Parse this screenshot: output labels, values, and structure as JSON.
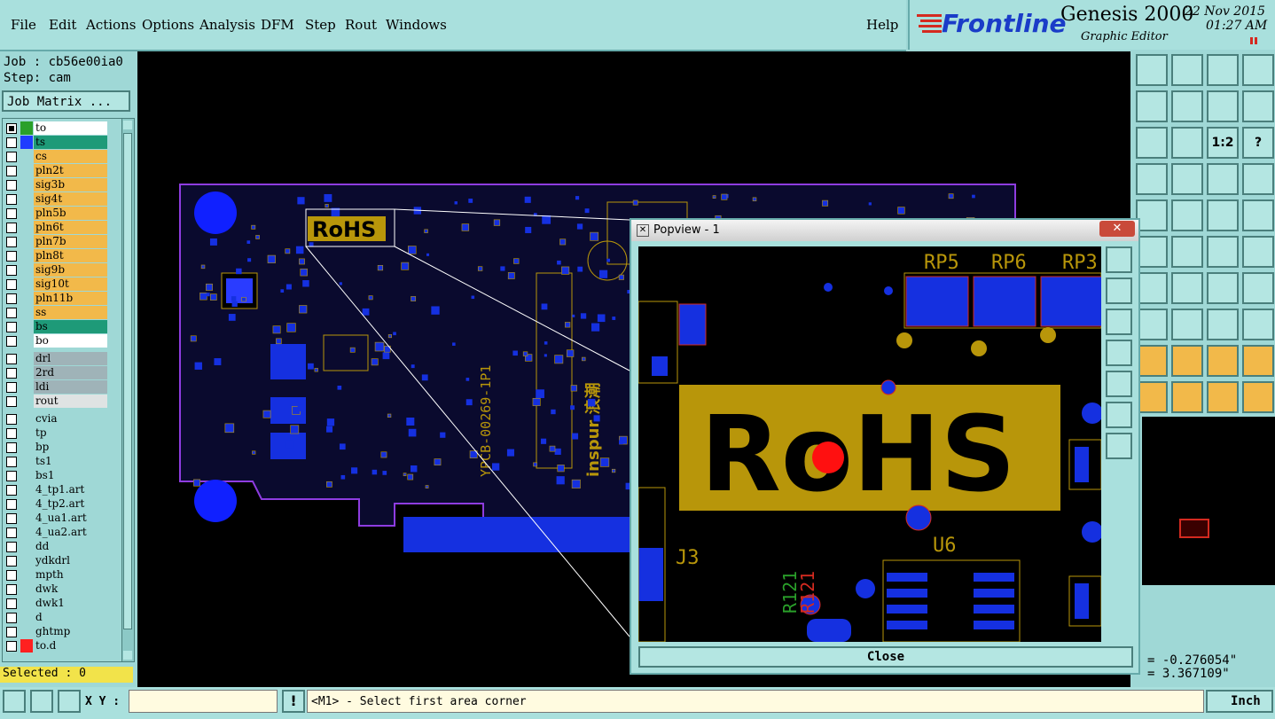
{
  "menu": {
    "items": [
      "File",
      "Edit",
      "Actions",
      "Options",
      "Analysis",
      "DFM",
      "Step",
      "Rout",
      "Windows"
    ],
    "help": "Help"
  },
  "brand": {
    "logo": "Frontline",
    "product": "Genesis 2000",
    "subtitle": "Graphic Editor",
    "date": "22 Nov 2015",
    "time": "01:27 AM"
  },
  "job": {
    "job_label": "Job : cb56e00ia0",
    "step_label": "Step: cam",
    "matrix_button": "Job Matrix ..."
  },
  "layers": [
    {
      "name": "to",
      "bg": "#ffffff",
      "color": "#2aa02a",
      "sel": true
    },
    {
      "name": "ts",
      "bg": "#1e9a78",
      "color": "#1f3cff",
      "sel": false
    },
    {
      "name": "cs",
      "bg": "#f2b94a",
      "color": "",
      "sel": false
    },
    {
      "name": "pln2t",
      "bg": "#f2b94a",
      "color": "",
      "sel": false
    },
    {
      "name": "sig3b",
      "bg": "#f2b94a",
      "color": "",
      "sel": false
    },
    {
      "name": "sig4t",
      "bg": "#f2b94a",
      "color": "",
      "sel": false
    },
    {
      "name": "pln5b",
      "bg": "#f2b94a",
      "color": "",
      "sel": false
    },
    {
      "name": "pln6t",
      "bg": "#f2b94a",
      "color": "",
      "sel": false
    },
    {
      "name": "pln7b",
      "bg": "#f2b94a",
      "color": "",
      "sel": false
    },
    {
      "name": "pln8t",
      "bg": "#f2b94a",
      "color": "",
      "sel": false
    },
    {
      "name": "sig9b",
      "bg": "#f2b94a",
      "color": "",
      "sel": false
    },
    {
      "name": "sig10t",
      "bg": "#f2b94a",
      "color": "",
      "sel": false
    },
    {
      "name": "pln11b",
      "bg": "#f2b94a",
      "color": "",
      "sel": false
    },
    {
      "name": "ss",
      "bg": "#f2b94a",
      "color": "",
      "sel": false
    },
    {
      "name": "bs",
      "bg": "#1e9a78",
      "color": "",
      "sel": false
    },
    {
      "name": "bo",
      "bg": "#ffffff",
      "color": "",
      "sel": false
    },
    {
      "name": "drl",
      "bg": "#9fb3b8",
      "color": "",
      "sel": false
    },
    {
      "name": "2rd",
      "bg": "#9fb3b8",
      "color": "",
      "sel": false
    },
    {
      "name": "ldi",
      "bg": "#9fb3b8",
      "color": "",
      "sel": false
    },
    {
      "name": "rout",
      "bg": "#dfe3e3",
      "color": "",
      "sel": false
    },
    {
      "name": "cvia",
      "bg": "#9fd8d6",
      "color": "",
      "sel": false
    },
    {
      "name": "tp",
      "bg": "#9fd8d6",
      "color": "",
      "sel": false
    },
    {
      "name": "bp",
      "bg": "#9fd8d6",
      "color": "",
      "sel": false
    },
    {
      "name": "ts1",
      "bg": "#9fd8d6",
      "color": "",
      "sel": false
    },
    {
      "name": "bs1",
      "bg": "#9fd8d6",
      "color": "",
      "sel": false
    },
    {
      "name": "4_tp1.art",
      "bg": "#9fd8d6",
      "color": "",
      "sel": false
    },
    {
      "name": "4_tp2.art",
      "bg": "#9fd8d6",
      "color": "",
      "sel": false
    },
    {
      "name": "4_ua1.art",
      "bg": "#9fd8d6",
      "color": "",
      "sel": false
    },
    {
      "name": "4_ua2.art",
      "bg": "#9fd8d6",
      "color": "",
      "sel": false
    },
    {
      "name": "dd",
      "bg": "#9fd8d6",
      "color": "",
      "sel": false
    },
    {
      "name": "ydkdrl",
      "bg": "#9fd8d6",
      "color": "",
      "sel": false
    },
    {
      "name": "mpth",
      "bg": "#9fd8d6",
      "color": "",
      "sel": false
    },
    {
      "name": "dwk",
      "bg": "#9fd8d6",
      "color": "",
      "sel": false
    },
    {
      "name": "dwk1",
      "bg": "#9fd8d6",
      "color": "",
      "sel": false
    },
    {
      "name": "d",
      "bg": "#9fd8d6",
      "color": "",
      "sel": false
    },
    {
      "name": "ghtmp",
      "bg": "#9fd8d6",
      "color": "",
      "sel": false
    },
    {
      "name": "to.d",
      "bg": "#9fd8d6",
      "color": "#ff2020",
      "sel": false
    }
  ],
  "selected_label": "Selected : 0",
  "popview": {
    "title": "Popview - 1",
    "close": "Close",
    "labels": {
      "rp5": "RP5",
      "rp6": "RP6",
      "rp3": "RP3",
      "rohs": "RoHS",
      "u6": "U6",
      "j3": "J3",
      "r121": "R121"
    }
  },
  "board": {
    "rohs": "RoHS",
    "pcb_text": "YPCB-00269-1P1",
    "brand_text": "inspur 浪潮"
  },
  "coords": {
    "x": "= -0.276054\"",
    "y": "= 3.367109\""
  },
  "status": {
    "xy_label": "X Y :",
    "xy_value": "",
    "prompt": "<M1> - Select first area corner",
    "units": "Inch"
  },
  "toolbox_labels": {
    "t12": "1:2",
    "help": "?"
  }
}
